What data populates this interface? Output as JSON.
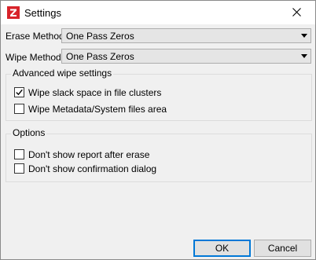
{
  "window": {
    "title": "Settings",
    "icon": "z-logo-icon"
  },
  "erase_method": {
    "label": "Erase Method",
    "value": "One Pass Zeros"
  },
  "wipe_method": {
    "label": "Wipe Method",
    "value": "One Pass Zeros"
  },
  "advanced": {
    "title": "Advanced wipe settings",
    "items": [
      {
        "label": "Wipe slack space in file clusters",
        "checked": true
      },
      {
        "label": "Wipe Metadata/System files area",
        "checked": false
      }
    ]
  },
  "options": {
    "title": "Options",
    "items": [
      {
        "label": "Don't show report after erase",
        "checked": false
      },
      {
        "label": "Don't show confirmation dialog",
        "checked": false
      }
    ]
  },
  "buttons": {
    "ok": "OK",
    "cancel": "Cancel"
  },
  "colors": {
    "accent": "#0078d7",
    "brand_red": "#d8232a"
  }
}
